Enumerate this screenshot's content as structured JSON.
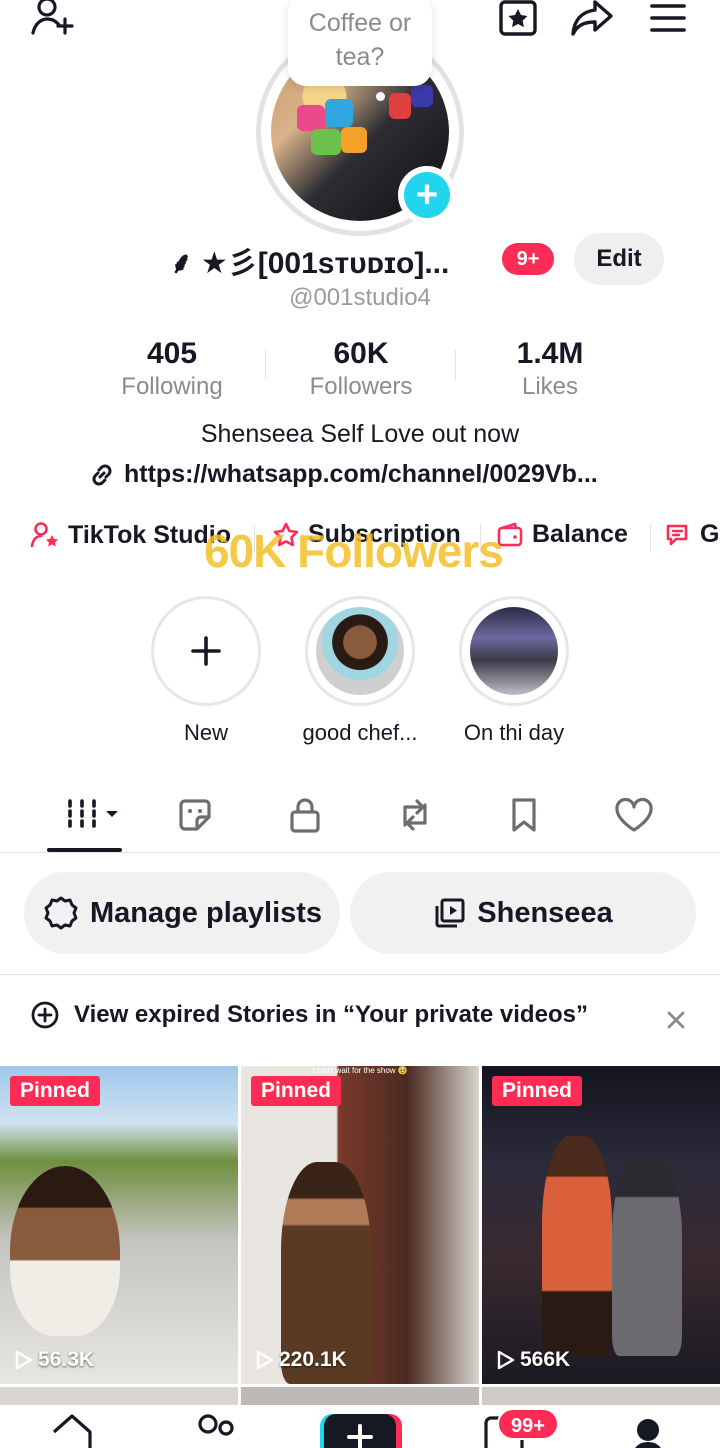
{
  "top_bar": {
    "add_friend_icon": "person-plus-icon",
    "favorites_icon": "star-box-icon",
    "share_icon": "share-arrow-icon",
    "menu_icon": "hamburger-menu-icon"
  },
  "avatar": {
    "note_bubble": "Coffee or tea?",
    "add_icon": "plus-icon"
  },
  "profile": {
    "display_name": "⸙ ★彡[001sᴛᴜᴅɪᴏ]...",
    "notification_count": "9+",
    "edit_label": "Edit",
    "username": "@001studio4"
  },
  "stats": [
    {
      "value": "405",
      "label": "Following"
    },
    {
      "value": "60K",
      "label": "Followers"
    },
    {
      "value": "1.4M",
      "label": "Likes"
    }
  ],
  "bio": {
    "text": "Shenseea Self Love out now",
    "link": "https://whatsapp.com/channel/0029Vb..."
  },
  "shortcuts": [
    {
      "label": "TikTok Studio",
      "icon": "person-star-icon"
    },
    {
      "label": "Subscription",
      "icon": "star-outline-icon"
    },
    {
      "label": "Balance",
      "icon": "wallet-icon"
    },
    {
      "label": "G",
      "icon": "chat-icon"
    }
  ],
  "overlay_text": "60K Followers",
  "stories": [
    {
      "label": "New",
      "icon": "plus-icon"
    },
    {
      "label": "good chef..."
    },
    {
      "label": "On thi day"
    }
  ],
  "tabs": {
    "videos_icon": "grid-bars-icon",
    "stickers_icon": "sticker-icon",
    "private_icon": "lock-icon",
    "reposts_icon": "repost-icon",
    "saved_icon": "bookmark-icon",
    "liked_icon": "heart-icon"
  },
  "actions": {
    "manage_playlists": "Manage playlists",
    "playlist_name": "Shenseea"
  },
  "notice": {
    "text": "View expired Stories in “Your private videos”"
  },
  "videos": [
    {
      "pinned": "Pinned",
      "views": "56.3K",
      "caption": ""
    },
    {
      "pinned": "Pinned",
      "views": "220.1K",
      "caption": "I can't wait for the show 🥹"
    },
    {
      "pinned": "Pinned",
      "views": "566K",
      "caption": ""
    }
  ],
  "bottom_nav": {
    "inbox_badge": "99+"
  },
  "colors": {
    "accent_red": "#fe2c55",
    "accent_cyan": "#20d5ec",
    "text_primary": "#161823",
    "text_secondary": "#8a8b91"
  }
}
